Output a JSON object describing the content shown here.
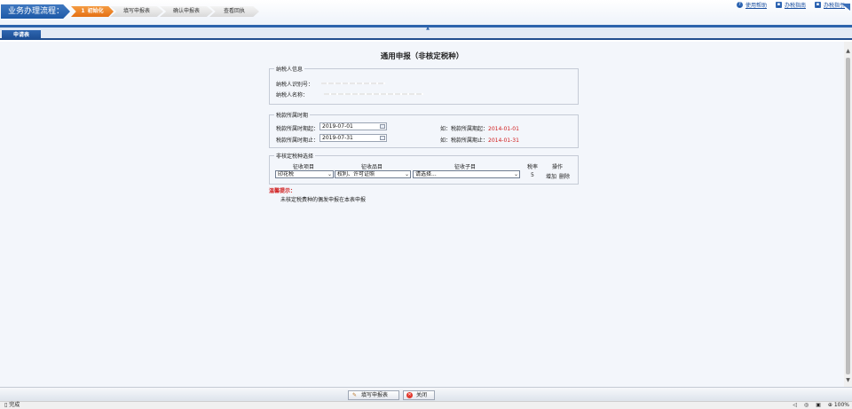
{
  "header": {
    "flow_title": "业务办理流程：",
    "steps": [
      {
        "num": "1",
        "label": "初始化",
        "state": "active"
      },
      {
        "num": "",
        "label": "填写申报表",
        "state": "inactive"
      },
      {
        "num": "",
        "label": "确认申报表",
        "state": "inactive"
      },
      {
        "num": "",
        "label": "查看回执",
        "state": "inactive"
      }
    ],
    "help_links": [
      {
        "label": "使用帮助",
        "icon": "question-icon"
      },
      {
        "label": "办税指南",
        "icon": "book-icon"
      },
      {
        "label": "办税指引",
        "icon": "guide-icon"
      }
    ]
  },
  "tabs": [
    {
      "label": "申请表"
    }
  ],
  "form": {
    "title": "通用申报（非核定税种）",
    "taxpayer": {
      "legend": "纳税人信息",
      "id_label": "纳税人识别号：",
      "name_label": "纳税人名称："
    },
    "period": {
      "legend": "税款所属时期",
      "start_label": "税款所属时期起：",
      "start_value": "2019-07-01",
      "end_label": "税款所属时期止：",
      "end_value": "2019-07-31",
      "start_example_prefix": "如：税款所属期起：",
      "start_example_value": "2014-01-01",
      "end_example_prefix": "如：税款所属期止：",
      "end_example_value": "2014-01-31"
    },
    "taxtype": {
      "legend": "非核定税种选择",
      "headers": [
        "征收项目",
        "征收品目",
        "征收子目",
        "税率",
        "操作"
      ],
      "row": {
        "item": "印花税",
        "category": "权利、许可证照",
        "subitem": "请选择...",
        "rate": "5",
        "add": "增加",
        "delete": "删除"
      }
    },
    "hint_title": "温馨提示：",
    "hint_body": "未核定税费种的偶发申报在本表申报"
  },
  "buttons": {
    "fill": "填写申报表",
    "close": "关闭"
  },
  "status": {
    "left": "完成",
    "zoom": "100%"
  }
}
